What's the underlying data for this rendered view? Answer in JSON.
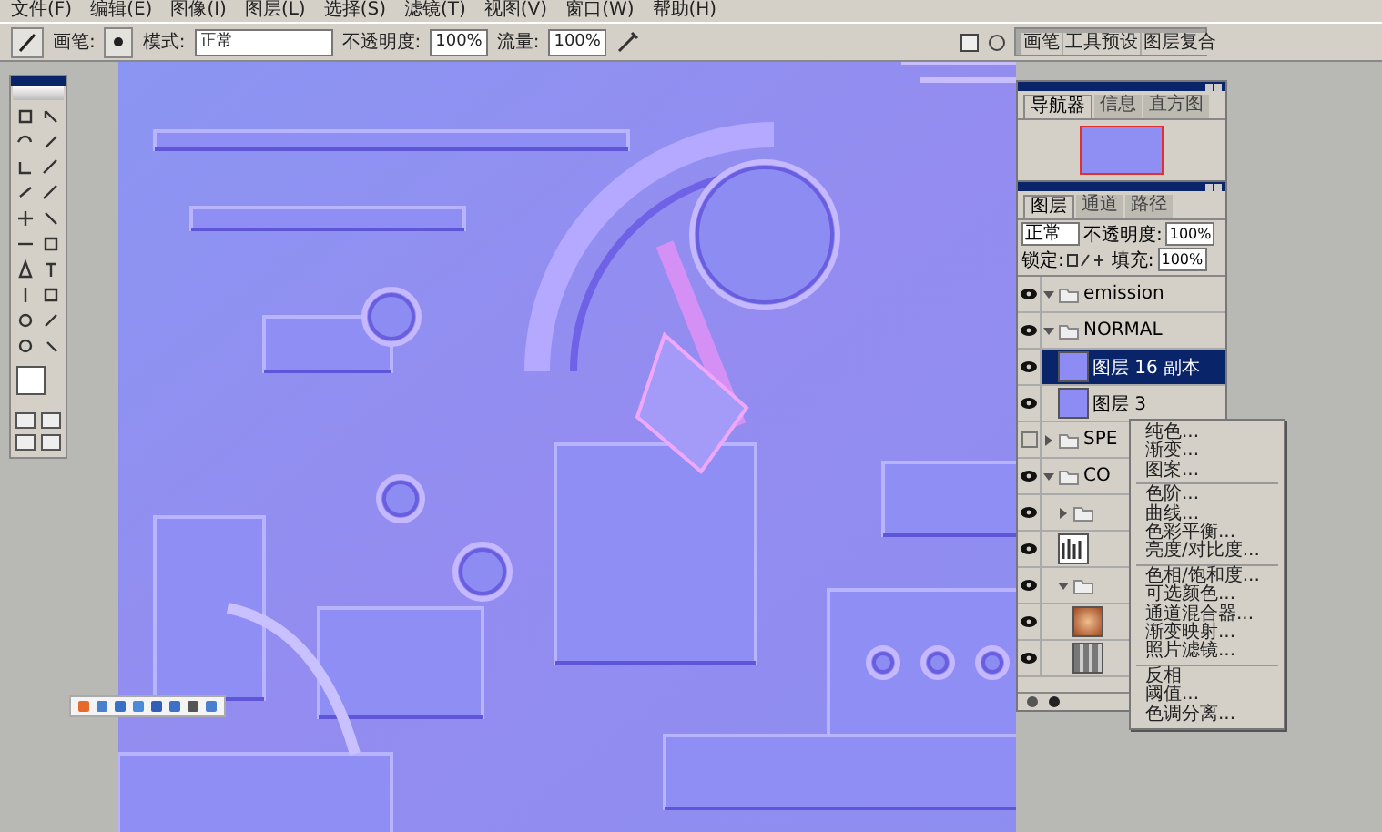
{
  "menu_bar": {
    "items": [
      "文件(F)",
      "编辑(E)",
      "图像(I)",
      "图层(L)",
      "选择(S)",
      "滤镜(T)",
      "视图(V)",
      "窗口(W)",
      "帮助(H)"
    ]
  },
  "options_bar": {
    "brush_label": "画笔:",
    "mode_label": "模式:",
    "mode_value": "正常",
    "opacity_label": "不透明度:",
    "opacity_value": "100%",
    "flow_label": "流量:",
    "flow_value": "100%"
  },
  "palette_well": {
    "tabs": [
      "画笔",
      "工具预设",
      "图层复合"
    ]
  },
  "navigator": {
    "tabs": [
      {
        "label": "导航器",
        "selected": true
      },
      {
        "label": "信息",
        "selected": false
      },
      {
        "label": "直方图",
        "selected": false
      }
    ]
  },
  "layers_panel": {
    "tabs": [
      {
        "label": "图层",
        "selected": true
      },
      {
        "label": "通道",
        "selected": false
      },
      {
        "label": "路径",
        "selected": false
      }
    ],
    "blend_mode": "正常",
    "opacity_label": "不透明度:",
    "opacity_value": "100%",
    "lock_label": "锁定:",
    "fill_label": "填充:",
    "fill_value": "100%",
    "layers": [
      {
        "kind": "group",
        "name": "emission",
        "visible": true,
        "expanded": true,
        "selected": false
      },
      {
        "kind": "group",
        "name": "NORMAL",
        "visible": true,
        "expanded": true,
        "selected": false,
        "children": [
          {
            "kind": "layer",
            "name": "图层 16 副本",
            "visible": true,
            "selected": true
          },
          {
            "kind": "layer",
            "name": "图层 3",
            "visible": true,
            "selected": false
          }
        ]
      },
      {
        "kind": "group",
        "name": "SPE",
        "visible": false,
        "expanded": false,
        "selected": false
      },
      {
        "kind": "group",
        "name": "CO",
        "visible": true,
        "expanded": true,
        "selected": false,
        "children": [
          {
            "kind": "group",
            "visible": true,
            "expanded": false,
            "selected": false
          },
          {
            "kind": "adjustment",
            "visible": true,
            "selected": false
          },
          {
            "kind": "group",
            "visible": true,
            "expanded": true,
            "selected": false,
            "children": [
              {
                "kind": "photo",
                "visible": true,
                "selected": false
              },
              {
                "kind": "pattern",
                "visible": true,
                "selected": false
              }
            ]
          }
        ]
      }
    ]
  },
  "context_menu": {
    "sections": [
      [
        "纯色...",
        "渐变...",
        "图案..."
      ],
      [
        "色阶...",
        "曲线...",
        "色彩平衡...",
        "亮度/对比度..."
      ],
      [
        "色相/饱和度...",
        "可选颜色...",
        "通道混合器...",
        "渐变映射...",
        "照片滤镜..."
      ],
      [
        "反相",
        "阈值...",
        "色调分离..."
      ]
    ]
  }
}
